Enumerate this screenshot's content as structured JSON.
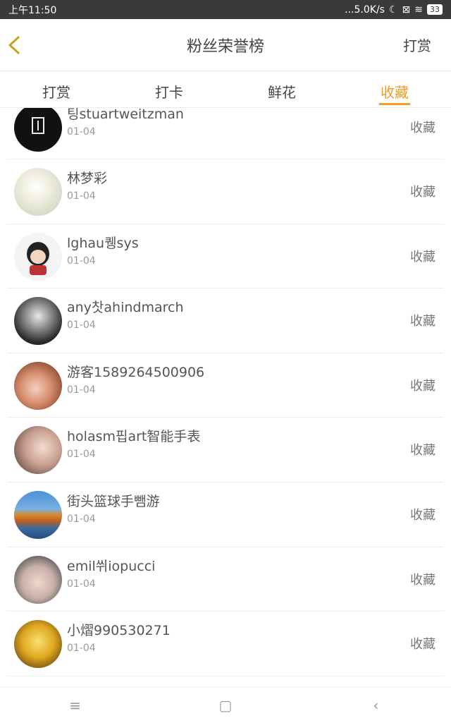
{
  "status_bar": {
    "time": "上午11:50",
    "speed": "...5.0K/s",
    "battery": "33"
  },
  "header": {
    "title": "粉丝荣誉榜",
    "right_action": "打赏"
  },
  "tabs": [
    {
      "label": "打赏"
    },
    {
      "label": "打卡"
    },
    {
      "label": "鲜花"
    },
    {
      "label": "收藏"
    }
  ],
  "active_tab": "收藏",
  "rows": [
    {
      "name": "팅stuartweitzman",
      "date": "01-04",
      "action": "收藏"
    },
    {
      "name": "林梦彩",
      "date": "01-04",
      "action": "收藏"
    },
    {
      "name": "lghau퀭sys",
      "date": "01-04",
      "action": "收藏"
    },
    {
      "name": "any찻ahindmarch",
      "date": "01-04",
      "action": "收藏"
    },
    {
      "name": "游客1589264500906",
      "date": "01-04",
      "action": "收藏"
    },
    {
      "name": "holasm핍art智能手表",
      "date": "01-04",
      "action": "收藏"
    },
    {
      "name": "街头篮球手뺌游",
      "date": "01-04",
      "action": "收藏"
    },
    {
      "name": "emil쒸iopucci",
      "date": "01-04",
      "action": "收藏"
    },
    {
      "name": "小熠990530271",
      "date": "01-04",
      "action": "收藏"
    }
  ],
  "colors": {
    "accent": "#f0a020",
    "text": "#444444",
    "muted": "#999999"
  },
  "nav": {
    "menu_icon": "≡",
    "home_icon": "▢",
    "back_icon": "‹"
  }
}
